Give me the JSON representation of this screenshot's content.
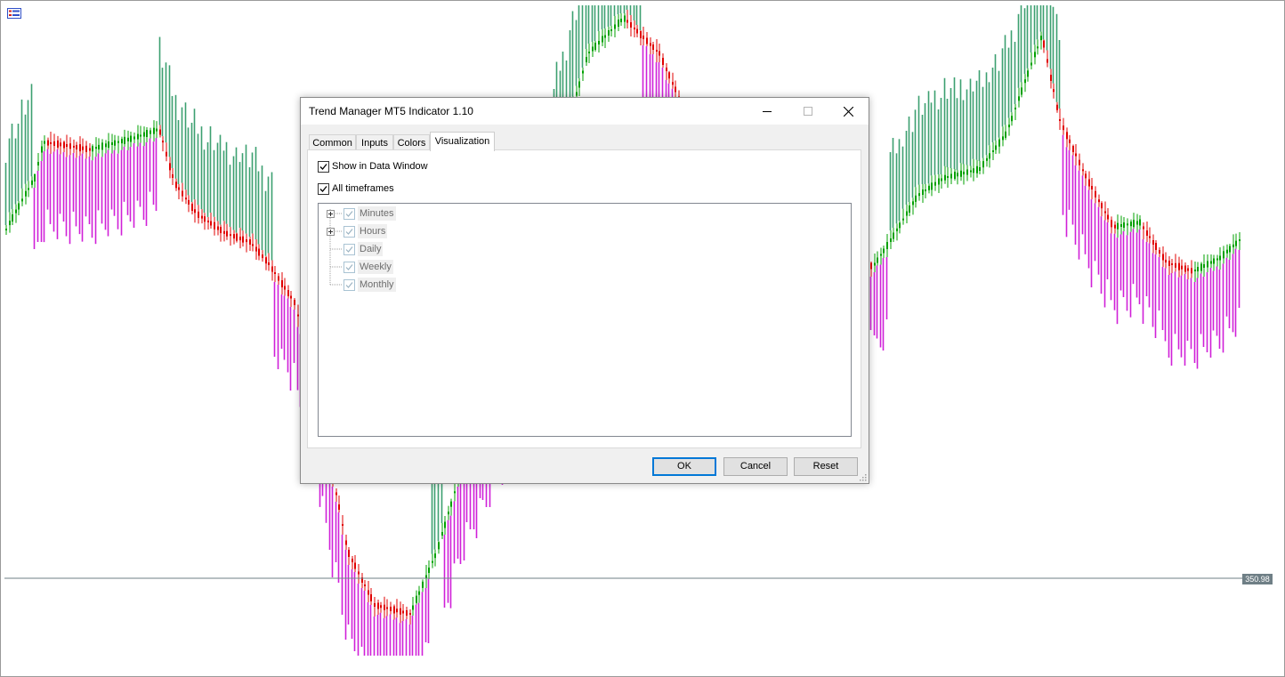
{
  "chart": {
    "price_label": "350.98",
    "colors": {
      "bull_candle": "#00a000",
      "bear_candle": "#e00000",
      "up_histogram": "#3ca070",
      "down_histogram": "#d020d8",
      "price_line": "#6f7f86"
    }
  },
  "dialog": {
    "title": "Trend Manager MT5 Indicator 1.10",
    "tabs": [
      {
        "label": "Common"
      },
      {
        "label": "Inputs"
      },
      {
        "label": "Colors"
      },
      {
        "label": "Visualization"
      }
    ],
    "active_tab": "Visualization",
    "show_in_data_window": {
      "label": "Show in Data Window",
      "checked": true
    },
    "all_timeframes": {
      "label": "All timeframes",
      "checked": true
    },
    "timeframes": [
      {
        "label": "Minutes",
        "expandable": true,
        "checked": true
      },
      {
        "label": "Hours",
        "expandable": true,
        "checked": true
      },
      {
        "label": "Daily",
        "expandable": false,
        "checked": true
      },
      {
        "label": "Weekly",
        "expandable": false,
        "checked": true
      },
      {
        "label": "Monthly",
        "expandable": false,
        "checked": true
      }
    ],
    "buttons": {
      "ok": "OK",
      "cancel": "Cancel",
      "reset": "Reset"
    }
  }
}
